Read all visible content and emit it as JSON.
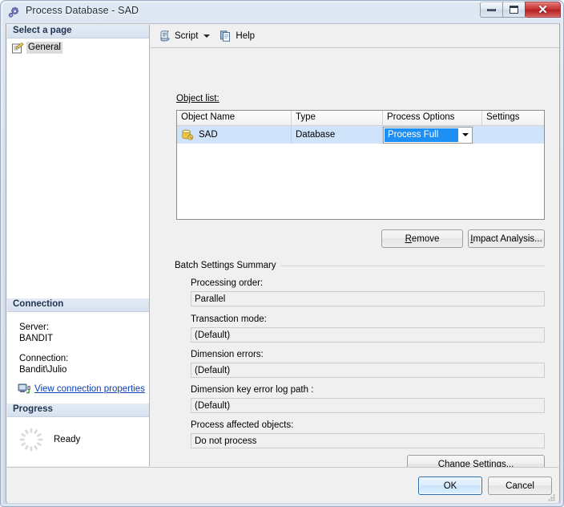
{
  "window": {
    "title": "Process Database - SAD",
    "icon": "gears-icon",
    "buttons": {
      "minimize": "Minimize",
      "maximize": "Maximize",
      "close": "Close"
    }
  },
  "sidebar": {
    "select_page_header": "Select a page",
    "pages": [
      {
        "label": "General",
        "icon": "page-general-icon",
        "selected": true
      }
    ],
    "connection_header": "Connection",
    "connection": {
      "server_label": "Server:",
      "server_value": "BANDIT",
      "connection_label": "Connection:",
      "connection_value": "Bandit\\Julio",
      "properties_link": "View connection properties",
      "properties_link_icon": "server-connection-icon"
    },
    "progress_header": "Progress",
    "progress": {
      "status": "Ready",
      "spinner_icon": "loading-spinner-icon"
    }
  },
  "toolbar": {
    "script_label": "Script",
    "script_icon": "script-icon",
    "script_dropdown_icon": "chevron-down-icon",
    "help_label": "Help",
    "help_icon": "help-page-icon"
  },
  "main": {
    "object_list_label": "Object list:",
    "grid": {
      "columns": [
        "Object Name",
        "Type",
        "Process Options",
        "Settings"
      ],
      "rows": [
        {
          "object_name": "SAD",
          "object_icon": "database-object-icon",
          "type": "Database",
          "process_options": "Process Full",
          "process_options_dropdown_icon": "chevron-down-icon",
          "settings": "",
          "selected": true
        }
      ]
    },
    "remove_button": "Remove",
    "impact_analysis_button": "Impact Analysis...",
    "batch_settings": {
      "group_title": "Batch Settings Summary",
      "fields": [
        {
          "label": "Processing order:",
          "value": "Parallel"
        },
        {
          "label": "Transaction mode:",
          "value": "(Default)"
        },
        {
          "label": "Dimension errors:",
          "value": "(Default)"
        },
        {
          "label": "Dimension key error log path :",
          "value": "(Default)"
        },
        {
          "label": "Process affected objects:",
          "value": "Do not process"
        }
      ],
      "change_settings_button": "Change Settings..."
    }
  },
  "footer": {
    "ok_button": "OK",
    "cancel_button": "Cancel"
  },
  "colors": {
    "accent_selection": "#cfe4fb",
    "combo_highlight": "#1e90f5",
    "link": "#0a3fb5",
    "dialog_bg": "#f0f0f0",
    "close_button": "#c23232"
  }
}
